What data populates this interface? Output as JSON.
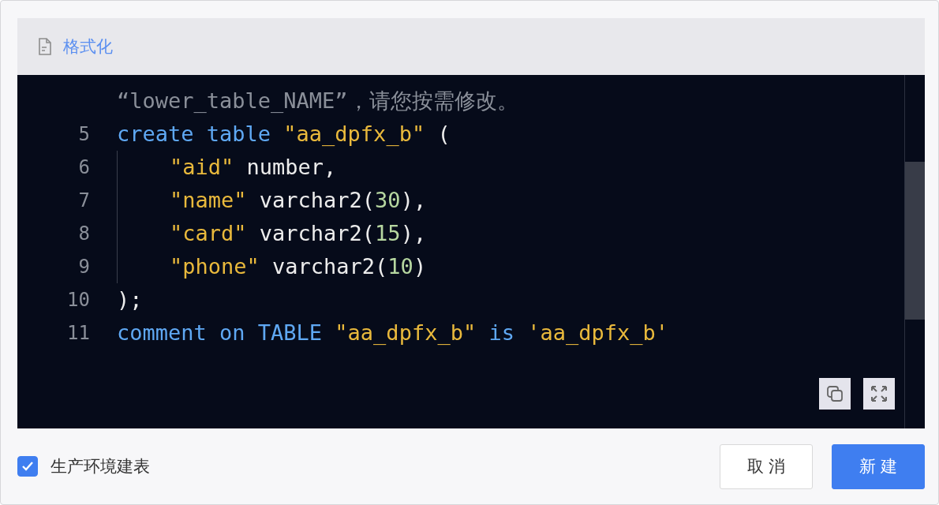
{
  "toolbar": {
    "label": "格式化"
  },
  "editor": {
    "lines": [
      {
        "indented": false,
        "tokens": [
          {
            "color": "#8a8f99",
            "text": "“lower_table_NAME”，请您按需修改。"
          }
        ]
      },
      {
        "number": "5",
        "indented": false,
        "tokens": [
          {
            "color": "#5fa8f3",
            "text": "create table"
          },
          {
            "color": "#e9b93c",
            "text": " \"aa_dpfx_b\""
          },
          {
            "color": "#ececec",
            "text": " ("
          }
        ]
      },
      {
        "number": "6",
        "indented": true,
        "tokens": [
          {
            "color": "#e9b93c",
            "text": "\"aid\""
          },
          {
            "color": "#ececec",
            "text": " number,"
          }
        ]
      },
      {
        "number": "7",
        "indented": true,
        "tokens": [
          {
            "color": "#e9b93c",
            "text": "\"name\""
          },
          {
            "color": "#ececec",
            "text": " varchar2("
          },
          {
            "color": "#b6d7a0",
            "text": "30"
          },
          {
            "color": "#ececec",
            "text": "),"
          }
        ]
      },
      {
        "number": "8",
        "indented": true,
        "tokens": [
          {
            "color": "#e9b93c",
            "text": "\"card\""
          },
          {
            "color": "#ececec",
            "text": " varchar2("
          },
          {
            "color": "#b6d7a0",
            "text": "15"
          },
          {
            "color": "#ececec",
            "text": "),"
          }
        ]
      },
      {
        "number": "9",
        "indented": true,
        "tokens": [
          {
            "color": "#e9b93c",
            "text": "\"phone\""
          },
          {
            "color": "#ececec",
            "text": " varchar2("
          },
          {
            "color": "#b6d7a0",
            "text": "10"
          },
          {
            "color": "#ececec",
            "text": ")"
          }
        ]
      },
      {
        "number": "10",
        "indented": false,
        "tokens": [
          {
            "color": "#ececec",
            "text": ");"
          }
        ]
      },
      {
        "number": "11",
        "indented": false,
        "tokens": [
          {
            "color": "#5fa8f3",
            "text": "comment on TABLE"
          },
          {
            "color": "#e9b93c",
            "text": " \"aa_dpfx_b\""
          },
          {
            "color": "#5fa8f3",
            "text": " is"
          },
          {
            "color": "#e9b93c",
            "text": " 'aa_dpfx_b'"
          }
        ]
      }
    ]
  },
  "footer": {
    "checkbox": {
      "label": "生产环境建表",
      "checked": true
    },
    "buttons": [
      {
        "label": "取 消",
        "kind": "default"
      },
      {
        "label": "新 建",
        "kind": "primary"
      }
    ]
  }
}
